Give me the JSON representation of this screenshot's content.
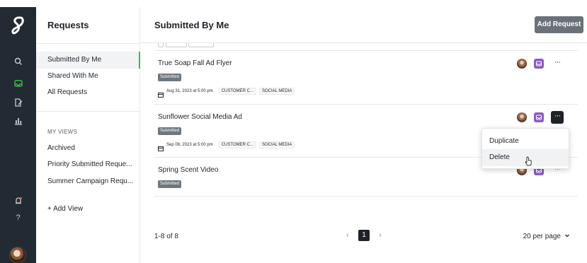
{
  "rail": {
    "icons": [
      "logo-icon",
      "search-icon",
      "inbox-icon",
      "edit-doc-icon",
      "chart-icon",
      "notification-icon",
      "help-icon",
      "avatar"
    ],
    "help_label": "?"
  },
  "sidebar": {
    "title": "Requests",
    "items": [
      {
        "label": "Submitted By Me",
        "active": true
      },
      {
        "label": "Shared With Me",
        "active": false
      },
      {
        "label": "All Requests",
        "active": false
      }
    ],
    "views_label": "MY VIEWS",
    "views": [
      {
        "label": "Archived"
      },
      {
        "label": "Priority Submitted Reque..."
      },
      {
        "label": "Summer Campaign Requ..."
      }
    ],
    "add_view_label": "+ Add View"
  },
  "main": {
    "title": "Submitted By Me",
    "add_request_label": "Add Request",
    "rows": [
      {
        "title": "True Soap Fall Ad Flyer",
        "status": "Submitted",
        "date": "Aug 31, 2023 at 5:00 pm",
        "tags": [
          "CUSTOMER C...",
          "SOCIAL MEDIA"
        ],
        "menu_open": false
      },
      {
        "title": "Sunflower Social Media Ad",
        "status": "Submitted",
        "date": "Sep 08, 2023 at 5:00 pm",
        "tags": [
          "CUSTOMER C...",
          "SOCIAL MEDIA"
        ],
        "menu_open": true
      },
      {
        "title": "Spring Scent Video",
        "status": "Submitted",
        "date": "",
        "tags": [],
        "menu_open": false
      }
    ],
    "more_label": "···",
    "range_label": "1-8 of 8",
    "prev_label": "‹",
    "next_label": "›",
    "current_page": "1",
    "per_page_label": "20 per page"
  },
  "dropdown": {
    "items": [
      {
        "label": "Duplicate"
      },
      {
        "label": "Delete",
        "hover": true
      }
    ]
  },
  "colors": {
    "rail_bg": "#222a33",
    "active_indicator": "#3fb950",
    "accent_purple": "#8b5ac6",
    "button_gray": "#6a7178",
    "status_gray": "#6f777e"
  }
}
